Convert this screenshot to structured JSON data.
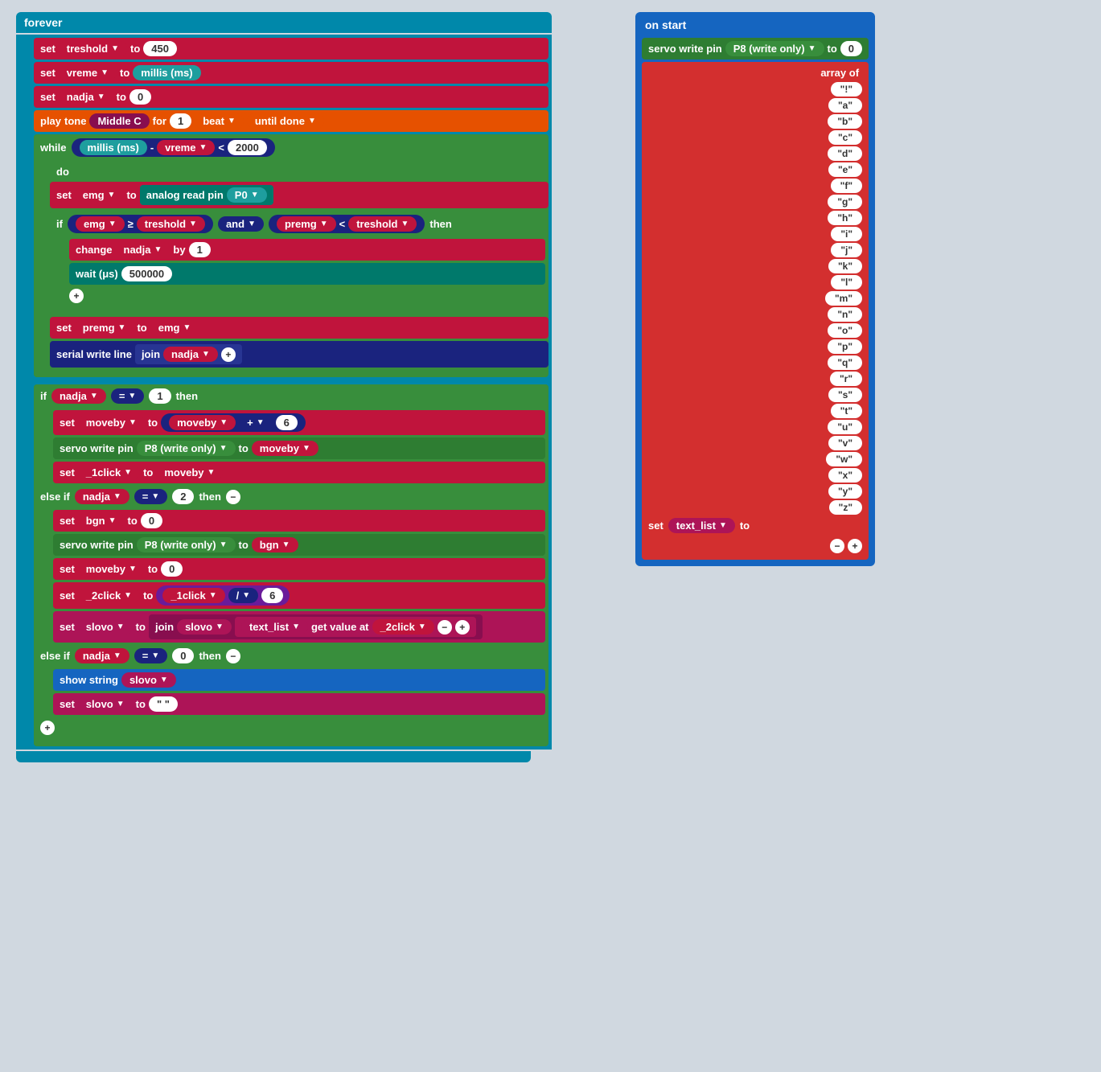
{
  "forever": {
    "label": "forever"
  },
  "blocks": {
    "set_treshold": "set",
    "treshold_var": "treshold",
    "to_label": "to",
    "val_450": "450",
    "set_vreme": "set",
    "vreme_var": "vreme",
    "millis_ms": "millis (ms)",
    "set_nadja": "set",
    "nadja_var": "nadja",
    "val_0": "0",
    "play_label": "play",
    "tone_label": "tone",
    "middle_c": "Middle C",
    "for_label": "for",
    "beat_val": "1",
    "beat_label": "beat",
    "until_done": "until done",
    "while_label": "while",
    "minus_op": "-",
    "lt_op": "<",
    "val_2000": "2000",
    "do_label": "do",
    "set_emg": "set",
    "emg_var": "emg",
    "analog_read_pin": "analog read pin",
    "p0_pin": "P0",
    "if_label": "if",
    "gte_op": "≥",
    "and_label": "and",
    "premg_var": "premg",
    "lt_op2": "<",
    "then_label": "then",
    "change_label": "change",
    "by_label": "by",
    "val_1": "1",
    "wait_us": "wait (μs)",
    "val_500000": "500000",
    "set_premg": "set",
    "to_emg": "emg",
    "serial_write": "serial write line",
    "join_label": "join",
    "if2_label": "if",
    "nadja_var2": "nadja",
    "eq_op": "=",
    "val_1b": "1",
    "then2_label": "then",
    "set_moveby": "set",
    "moveby_var": "moveby",
    "plus_op": "+",
    "val_6": "6",
    "servo_write": "servo write pin",
    "p8_pin": "P8 (write only)",
    "to_moveby": "moveby",
    "set_1click": "set",
    "click1_var": "_1click",
    "to_moveby2": "moveby",
    "else_if1": "else if",
    "nadja_var3": "nadja",
    "eq2_op": "=",
    "val_2": "2",
    "then3_label": "then",
    "set_bgn": "set",
    "bgn_var": "bgn",
    "val_0b": "0",
    "servo_write2": "servo write pin",
    "p8_pin2": "P8 (write only)",
    "to_bgn": "bgn",
    "set_moveby2": "set",
    "moveby_var2": "moveby",
    "val_0c": "0",
    "set_2click": "set",
    "click2_var": "_2click",
    "click1_val": "_1click",
    "div_op": "/",
    "val_6b": "6",
    "set_slovo": "set",
    "slovo_var": "slovo",
    "join2_label": "join",
    "slovo_var2": "slovo",
    "text_list_var": "text_list",
    "get_value_at": "get value at",
    "click2_val": "_2click",
    "else_if2": "else if",
    "nadja_var4": "nadja",
    "eq3_op": "=",
    "val_0d": "0",
    "then4_label": "then",
    "show_string": "show string",
    "slovo_var3": "slovo",
    "set_slovo2": "set",
    "slovo_var4": "slovo",
    "empty_str": "\" \"",
    "on_start": "on start",
    "servo_write_start": "servo write pin",
    "p8_start": "P8 (write only)",
    "to_start": "to",
    "val_0_start": "0",
    "array_of": "array of",
    "set_text_list": "set",
    "text_list_var2": "text_list",
    "to_label2": "to",
    "array_items": [
      "\"!\"",
      "\"a\"",
      "\"b\"",
      "\"c\"",
      "\"d\"",
      "\"e\"",
      "\"f\"",
      "\"g\"",
      "\"h\"",
      "\"i\"",
      "\"j\"",
      "\"k\"",
      "\"l\"",
      "\"m\"",
      "\"n\"",
      "\"o\"",
      "\"p\"",
      "\"q\"",
      "\"r\"",
      "\"s\"",
      "\"t\"",
      "\"u\"",
      "\"v\"",
      "\"w\"",
      "\"x\"",
      "\"y\"",
      "\"z\""
    ]
  }
}
